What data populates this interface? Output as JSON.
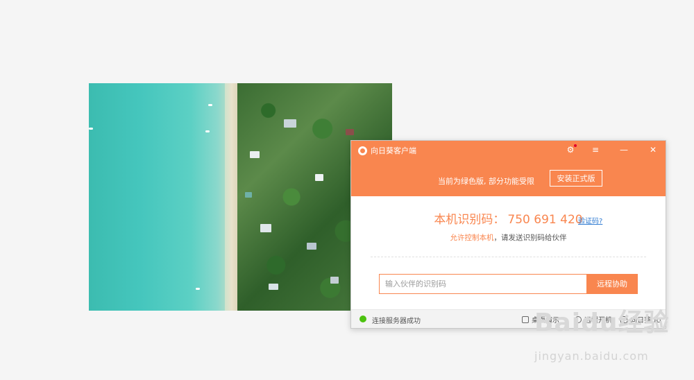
{
  "window": {
    "title": "向日葵客户端",
    "notice": "当前为绿色版, 部分功能受限",
    "install_label": "安装正式版",
    "icons": [
      "sunlogin-logo-icon",
      "gear-icon",
      "menu-icon",
      "minimize-icon",
      "close-icon"
    ]
  },
  "id_section": {
    "label": "本机识别码：",
    "code": "750 691 420",
    "verify_label": "验证码?",
    "allow_text": "允许控制本机",
    "send_text": "，请发送识别码给伙伴"
  },
  "connect": {
    "placeholder": "输入伙伴的识别码",
    "button_label": "远程协助"
  },
  "statusbar": {
    "status_text": "连接服务器成功",
    "status_color": "#4cc20f",
    "desktop_demo": "桌面演示",
    "remote_power": "远程开机",
    "uu": "向日葵UU"
  },
  "watermark": {
    "brand": "Baidu经验",
    "url": "jingyan.baidu.com"
  },
  "colors": {
    "accent": "#f9864f",
    "link": "#2f7bd2"
  }
}
